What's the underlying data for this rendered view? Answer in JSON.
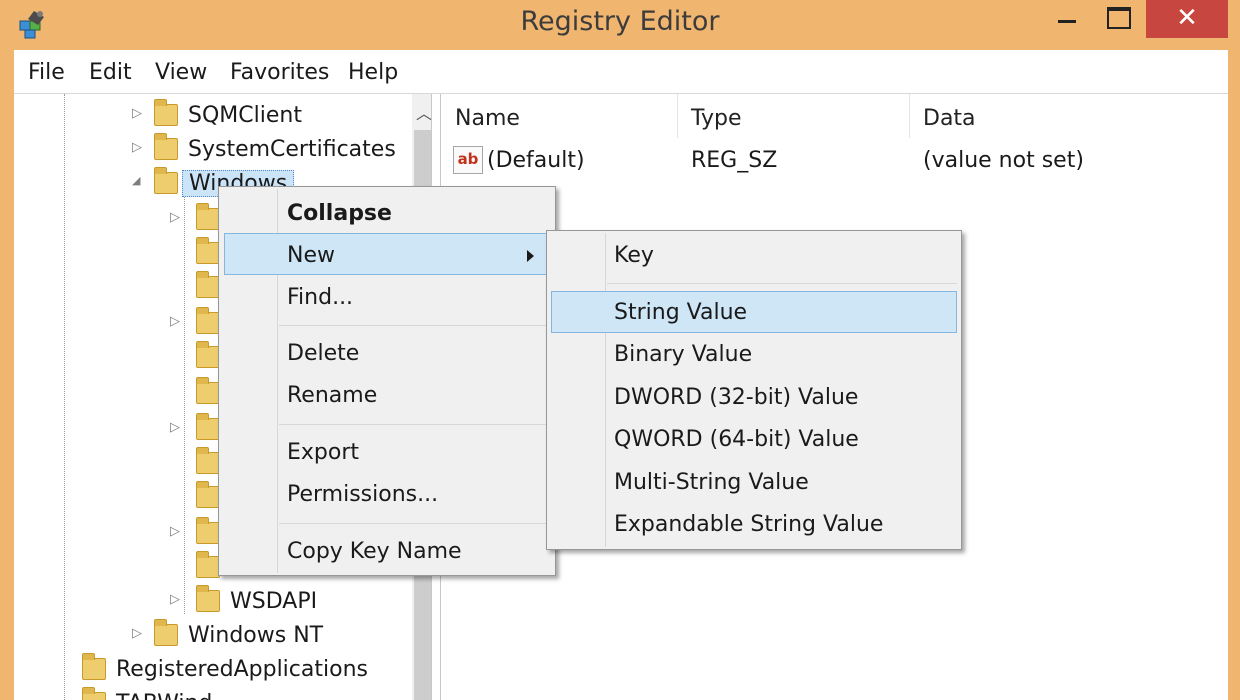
{
  "window": {
    "title": "Registry Editor",
    "close_glyph": "✕",
    "icons": {
      "app": "registry-editor-icon",
      "minimize": "minimize-icon",
      "maximize": "maximize-icon",
      "close": "close-icon"
    }
  },
  "menubar": [
    "File",
    "Edit",
    "View",
    "Favorites",
    "Help"
  ],
  "tree": {
    "nodes": [
      {
        "label": "SQMClient",
        "expander": "▷"
      },
      {
        "label": "SystemCertificates",
        "expander": "▷"
      },
      {
        "label": "Windows",
        "expander": "◢",
        "selected": true
      },
      {
        "label": "WSDAPI",
        "expander": "▷"
      },
      {
        "label": "Windows NT",
        "expander": "▷"
      },
      {
        "label": "RegisteredApplications",
        "expander": ""
      },
      {
        "label": "TABWind...",
        "expander": ""
      }
    ],
    "scroll_up_glyph": "︿"
  },
  "values": {
    "columns": [
      "Name",
      "Type",
      "Data"
    ],
    "rows": [
      {
        "icon_text": "ab",
        "name": "(Default)",
        "type": "REG_SZ",
        "data": "(value not set)"
      }
    ]
  },
  "context_menu": {
    "items": [
      "Collapse",
      "New",
      "Find...",
      "Delete",
      "Rename",
      "Export",
      "Permissions...",
      "Copy Key Name"
    ],
    "highlighted": "New"
  },
  "submenu": {
    "items": [
      "Key",
      "String Value",
      "Binary Value",
      "DWORD (32-bit) Value",
      "QWORD (64-bit) Value",
      "Multi-String Value",
      "Expandable String Value"
    ],
    "highlighted": "String Value"
  },
  "colors": {
    "title_bar": "#f0b56e",
    "close_button": "#c7463f",
    "highlight": "#cfe6f7",
    "highlight_border": "#84b6df"
  }
}
